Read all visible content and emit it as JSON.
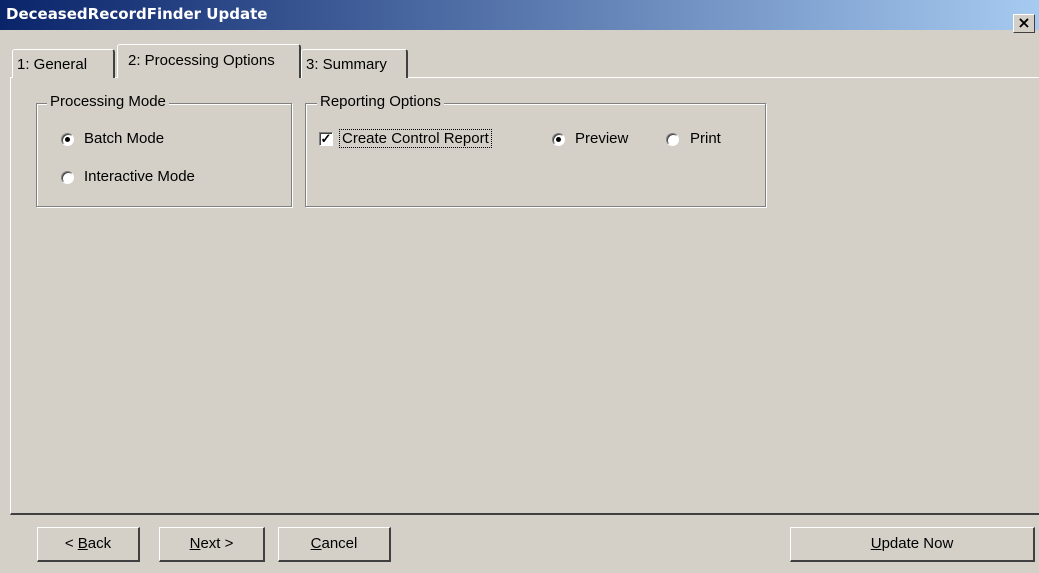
{
  "window": {
    "title": "DeceasedRecordFinder  Update",
    "close_glyph": "×"
  },
  "tabs": [
    {
      "label": "1: General",
      "active": false
    },
    {
      "label": "2: Processing Options",
      "active": true
    },
    {
      "label": "3: Summary",
      "active": false
    }
  ],
  "processing_mode": {
    "label": "Processing Mode",
    "options": [
      {
        "label": "Batch Mode",
        "selected": true
      },
      {
        "label": "Interactive Mode",
        "selected": false
      }
    ]
  },
  "reporting_options": {
    "label": "Reporting Options",
    "create_control_report": {
      "label": "Create Control Report",
      "checked": true,
      "glyph": "✓"
    },
    "preview": {
      "label": "Preview",
      "selected": true
    },
    "print": {
      "label": "Print",
      "selected": false
    }
  },
  "buttons": {
    "back": {
      "prefix": "< ",
      "accel": "B",
      "rest": "ack"
    },
    "next": {
      "accel": "N",
      "rest": "ext >"
    },
    "cancel": {
      "accel": "C",
      "rest": "ancel"
    },
    "update_now": {
      "accel": "U",
      "rest": "pdate Now"
    }
  }
}
